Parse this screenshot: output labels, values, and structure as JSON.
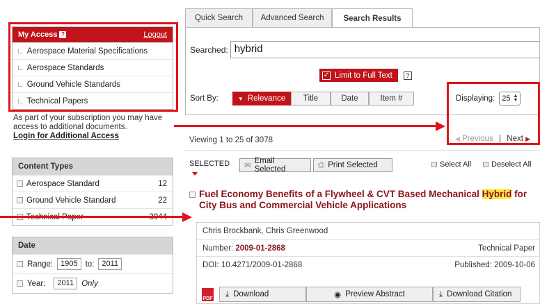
{
  "my_access": {
    "title": "My Access",
    "help": "?",
    "logout": "Logout",
    "items": [
      "Aerospace Material Specifications",
      "Aerospace Standards",
      "Ground Vehicle Standards",
      "Technical Papers"
    ],
    "note": "As part of your subscription you may have access to additional documents.",
    "login_link": "Login for Additional Access"
  },
  "content_types": {
    "title": "Content Types",
    "rows": [
      {
        "label": "Aerospace Standard",
        "count": "12"
      },
      {
        "label": "Ground Vehicle Standard",
        "count": "22"
      },
      {
        "label": "Technical Paper",
        "count": "3044"
      }
    ]
  },
  "date": {
    "title": "Date",
    "range_label": "Range:",
    "range_from": "1905",
    "to_label": "to:",
    "range_to": "2011",
    "year_label": "Year:",
    "year_value": "2011",
    "only": "Only"
  },
  "tabs": [
    "Quick Search",
    "Advanced Search",
    "Search Results"
  ],
  "search": {
    "searched_label": "Searched:",
    "query": "hybrid",
    "limit_label": "Limit to Full Text",
    "help": "?",
    "sort_label": "Sort By:",
    "sort_options": [
      "Relevance",
      "Title",
      "Date",
      "Item #"
    ],
    "displaying_label": "Displaying:",
    "displaying_value": "25"
  },
  "results_bar": {
    "viewing": "Viewing 1 to 25 of 3078",
    "previous": "Previous",
    "separator": "|",
    "next": "Next",
    "selected": "SELECTED",
    "email_selected": "Email Selected",
    "print_selected": "Print Selected",
    "select_all": "Select All",
    "deselect_all": "Deselect All"
  },
  "result": {
    "title_part1": "Fuel Economy Benefits of a Flywheel & CVT Based Mechanical ",
    "title_highlight": "Hybrid",
    "title_part2": " for City Bus and Commercial Vehicle Applications",
    "authors": "Chris Brockbank, Chris Greenwood",
    "number_label": "Number:",
    "number": "2009-01-2868",
    "doc_type": "Technical Paper",
    "doi": "DOI: 10.4271/2009-01-2868",
    "published": "Published: 2009-10-06",
    "pdf_label": "PDF",
    "download": "Download",
    "preview_abstract": "Preview Abstract",
    "download_citation": "Download Citation"
  },
  "colors": {
    "accent_red": "#c0141b",
    "annotation_red": "#e0151b",
    "highlight": "#ffe84a"
  }
}
